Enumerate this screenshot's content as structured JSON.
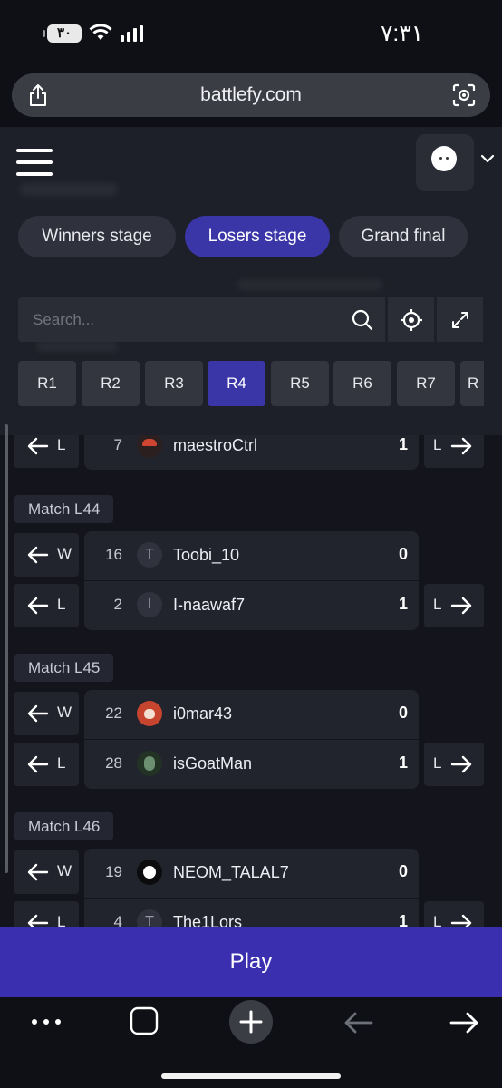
{
  "status_bar": {
    "battery": "٣٠",
    "time": "٧:٣١"
  },
  "browser": {
    "url": "battlefy.com"
  },
  "stage_tabs": [
    {
      "label": "Winners stage",
      "active": false
    },
    {
      "label": "Losers stage",
      "active": true
    },
    {
      "label": "Grand final",
      "active": false
    }
  ],
  "search": {
    "placeholder": "Search..."
  },
  "rounds": [
    {
      "label": "R1",
      "active": false
    },
    {
      "label": "R2",
      "active": false
    },
    {
      "label": "R3",
      "active": false
    },
    {
      "label": "R4",
      "active": true
    },
    {
      "label": "R5",
      "active": false
    },
    {
      "label": "R6",
      "active": false
    },
    {
      "label": "R7",
      "active": false
    },
    {
      "label": "R",
      "active": false
    }
  ],
  "matches": [
    {
      "label": "",
      "players": [
        {
          "side": "L",
          "seed": "7",
          "avatar": "hat",
          "initial": "",
          "name": "maestroCtrl",
          "score": "1",
          "next": "L"
        }
      ]
    },
    {
      "label": "Match L44",
      "players": [
        {
          "side": "W",
          "seed": "16",
          "avatar": "letter",
          "initial": "T",
          "name": "Toobi_10",
          "score": "0",
          "next": ""
        },
        {
          "side": "L",
          "seed": "2",
          "avatar": "letter",
          "initial": "I",
          "name": "I-naawaf7",
          "score": "1",
          "next": "L"
        }
      ]
    },
    {
      "label": "Match L45",
      "players": [
        {
          "side": "W",
          "seed": "22",
          "avatar": "fox",
          "initial": "",
          "name": "i0mar43",
          "score": "0",
          "next": ""
        },
        {
          "side": "L",
          "seed": "28",
          "avatar": "goat",
          "initial": "",
          "name": "isGoatMan",
          "score": "1",
          "next": "L"
        }
      ]
    },
    {
      "label": "Match L46",
      "players": [
        {
          "side": "W",
          "seed": "19",
          "avatar": "white",
          "initial": "",
          "name": "NEOM_TALAL7",
          "score": "0",
          "next": ""
        },
        {
          "side": "L",
          "seed": "4",
          "avatar": "letter",
          "initial": "T",
          "name": "The1Lors",
          "score": "1",
          "next": "L"
        }
      ]
    }
  ],
  "play_button": {
    "label": "Play"
  },
  "toolbar_icons": [
    "more-icon",
    "tabs-icon",
    "new-tab-icon",
    "back-icon",
    "forward-icon"
  ]
}
